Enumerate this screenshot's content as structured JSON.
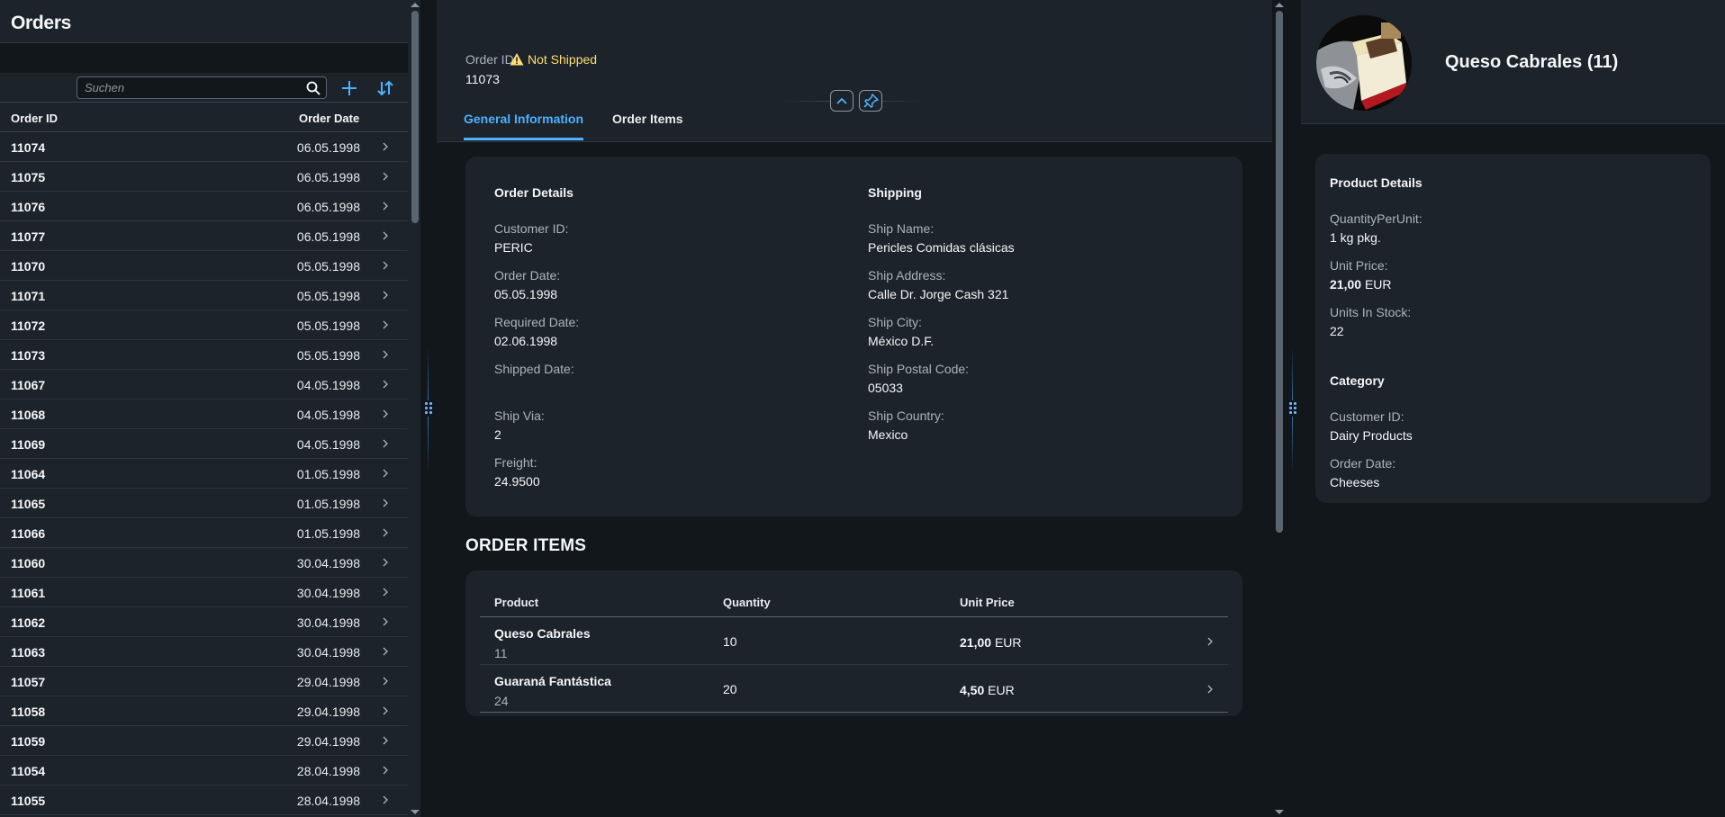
{
  "master": {
    "title": "Orders",
    "search_placeholder": "Suchen",
    "col_order_id": "Order ID",
    "col_order_date": "Order Date",
    "rows": [
      {
        "id": "11074",
        "date": "06.05.1998"
      },
      {
        "id": "11075",
        "date": "06.05.1998"
      },
      {
        "id": "11076",
        "date": "06.05.1998"
      },
      {
        "id": "11077",
        "date": "06.05.1998"
      },
      {
        "id": "11070",
        "date": "05.05.1998"
      },
      {
        "id": "11071",
        "date": "05.05.1998"
      },
      {
        "id": "11072",
        "date": "05.05.1998"
      },
      {
        "id": "11073",
        "date": "05.05.1998"
      },
      {
        "id": "11067",
        "date": "04.05.1998"
      },
      {
        "id": "11068",
        "date": "04.05.1998"
      },
      {
        "id": "11069",
        "date": "04.05.1998"
      },
      {
        "id": "11064",
        "date": "01.05.1998"
      },
      {
        "id": "11065",
        "date": "01.05.1998"
      },
      {
        "id": "11066",
        "date": "01.05.1998"
      },
      {
        "id": "11060",
        "date": "30.04.1998"
      },
      {
        "id": "11061",
        "date": "30.04.1998"
      },
      {
        "id": "11062",
        "date": "30.04.1998"
      },
      {
        "id": "11063",
        "date": "30.04.1998"
      },
      {
        "id": "11057",
        "date": "29.04.1998"
      },
      {
        "id": "11058",
        "date": "29.04.1998"
      },
      {
        "id": "11059",
        "date": "29.04.1998"
      },
      {
        "id": "11054",
        "date": "28.04.1998"
      },
      {
        "id": "11055",
        "date": "28.04.1998"
      }
    ]
  },
  "detail": {
    "order_id_label": "Order ID",
    "order_id": "11073",
    "status": "Not Shipped",
    "tabs": [
      "General Information",
      "Order Items"
    ],
    "order_details": {
      "title": "Order Details",
      "fields": [
        {
          "label": "Customer ID:",
          "value": "PERIC"
        },
        {
          "label": "Order Date:",
          "value": "05.05.1998"
        },
        {
          "label": "Required Date:",
          "value": "02.06.1998"
        },
        {
          "label": "Shipped Date:",
          "value": ""
        },
        {
          "label": "Ship Via:",
          "value": "2"
        },
        {
          "label": "Freight:",
          "value": "24.9500"
        }
      ]
    },
    "shipping": {
      "title": "Shipping",
      "fields": [
        {
          "label": "Ship Name:",
          "value": "Pericles Comidas clásicas"
        },
        {
          "label": "Ship Address:",
          "value": "Calle Dr. Jorge Cash 321"
        },
        {
          "label": "Ship City:",
          "value": "México D.F."
        },
        {
          "label": "Ship Postal Code:",
          "value": "05033"
        },
        {
          "label": "Ship Country:",
          "value": "Mexico"
        }
      ]
    },
    "order_items": {
      "title": "ORDER ITEMS",
      "columns": [
        "Product",
        "Quantity",
        "Unit Price"
      ],
      "items": [
        {
          "product": "Queso Cabrales",
          "product_id": "11",
          "quantity": "10",
          "price": "21,00",
          "currency": "EUR"
        },
        {
          "product": "Guaraná Fantástica",
          "product_id": "24",
          "quantity": "20",
          "price": "4,50",
          "currency": "EUR"
        }
      ]
    }
  },
  "product": {
    "title": "Queso Cabrales (11)",
    "details_title": "Product Details",
    "fields": [
      {
        "label": "QuantityPerUnit:",
        "value": "1 kg pkg."
      },
      {
        "label": "Unit Price:",
        "value": "21,00",
        "unit": "EUR"
      },
      {
        "label": "Units In Stock:",
        "value": "22"
      }
    ],
    "category_title": "Category",
    "category_fields": [
      {
        "label": "Customer ID:",
        "value": "Dairy Products"
      },
      {
        "label": "Order Date:",
        "value": "Cheeses"
      }
    ]
  },
  "colors": {
    "accent": "#4db1ff",
    "warning": "#ffdf72",
    "panel": "#1d232a",
    "background": "#12171c"
  }
}
